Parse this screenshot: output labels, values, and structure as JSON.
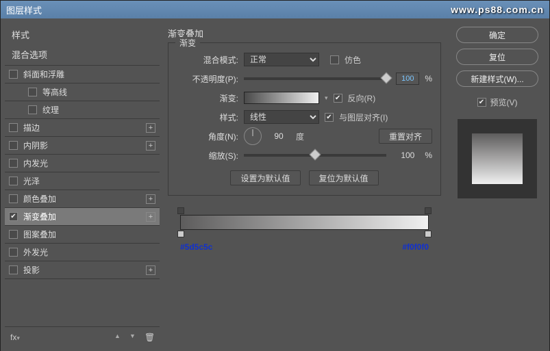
{
  "title": "图层样式",
  "watermark": "www.ps88.com.cn",
  "sidebar": {
    "styles_label": "样式",
    "blend_label": "混合选项",
    "items": [
      {
        "label": "斜面和浮雕",
        "checked": false,
        "indent": false,
        "plus": false
      },
      {
        "label": "等高线",
        "checked": false,
        "indent": true,
        "plus": false
      },
      {
        "label": "纹理",
        "checked": false,
        "indent": true,
        "plus": false
      },
      {
        "label": "描边",
        "checked": false,
        "indent": false,
        "plus": true
      },
      {
        "label": "内阴影",
        "checked": false,
        "indent": false,
        "plus": true
      },
      {
        "label": "内发光",
        "checked": false,
        "indent": false,
        "plus": false
      },
      {
        "label": "光泽",
        "checked": false,
        "indent": false,
        "plus": false
      },
      {
        "label": "颜色叠加",
        "checked": false,
        "indent": false,
        "plus": true
      },
      {
        "label": "渐变叠加",
        "checked": true,
        "indent": false,
        "plus": true,
        "selected": true
      },
      {
        "label": "图案叠加",
        "checked": false,
        "indent": false,
        "plus": false
      },
      {
        "label": "外发光",
        "checked": false,
        "indent": false,
        "plus": false
      },
      {
        "label": "投影",
        "checked": false,
        "indent": false,
        "plus": true
      }
    ]
  },
  "main": {
    "section_title": "渐变叠加",
    "group_title": "渐变",
    "blend_mode_label": "混合模式:",
    "blend_mode_value": "正常",
    "dither_label": "仿色",
    "opacity_label": "不透明度(P):",
    "opacity_value": "100",
    "pct": "%",
    "gradient_label": "渐变:",
    "reverse_label": "反向(R)",
    "style_label": "样式:",
    "style_value": "线性",
    "align_label": "与图层对齐(I)",
    "angle_label": "角度(N):",
    "angle_value": "90",
    "deg_label": "度",
    "reset_align": "重置对齐",
    "scale_label": "缩放(S):",
    "scale_value": "100",
    "make_default": "设置为默认值",
    "reset_default": "复位为默认值",
    "hex_left": "#5d5c5c",
    "hex_right": "#f0f0f0"
  },
  "right": {
    "ok": "确定",
    "reset": "复位",
    "new_style": "新建样式(W)...",
    "preview_label": "预览(V)"
  }
}
